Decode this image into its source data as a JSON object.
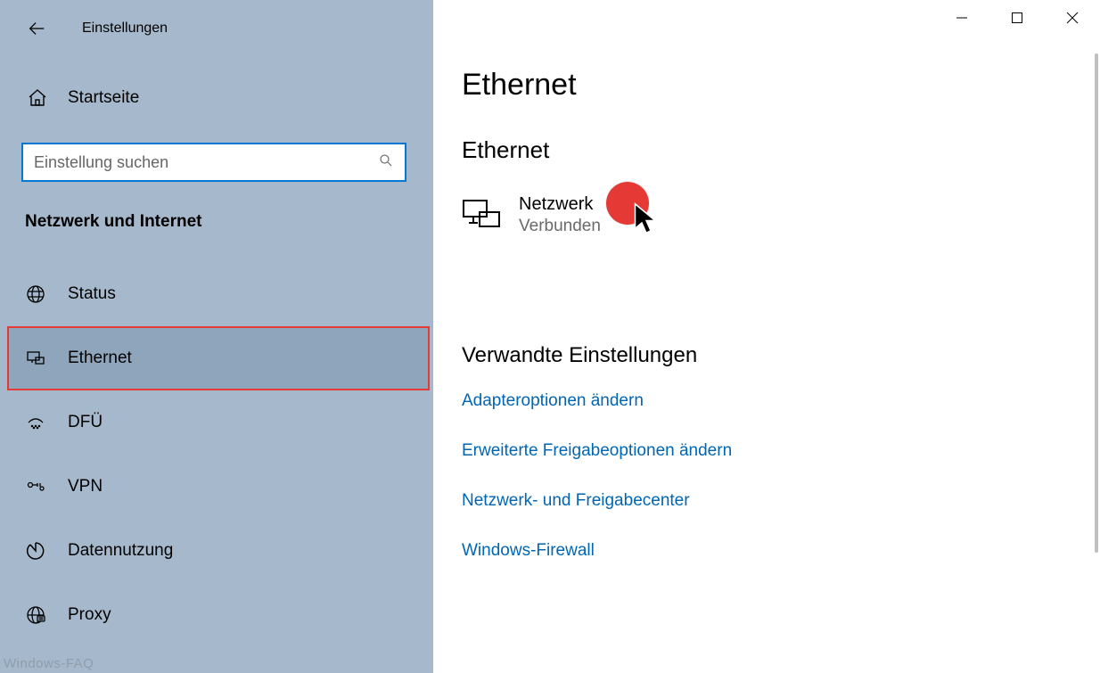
{
  "window": {
    "app_title": "Einstellungen"
  },
  "sidebar": {
    "home_label": "Startseite",
    "search_placeholder": "Einstellung suchen",
    "category_title": "Netzwerk und Internet",
    "items": [
      {
        "id": "status",
        "label": "Status",
        "selected": false
      },
      {
        "id": "ethernet",
        "label": "Ethernet",
        "selected": true
      },
      {
        "id": "dfu",
        "label": "DFÜ",
        "selected": false
      },
      {
        "id": "vpn",
        "label": "VPN",
        "selected": false
      },
      {
        "id": "datennutzung",
        "label": "Datennutzung",
        "selected": false
      },
      {
        "id": "proxy",
        "label": "Proxy",
        "selected": false
      }
    ]
  },
  "main": {
    "page_title": "Ethernet",
    "section_title": "Ethernet",
    "network": {
      "name": "Netzwerk",
      "status": "Verbunden"
    },
    "related_title": "Verwandte Einstellungen",
    "related_links": [
      "Adapteroptionen ändern",
      "Erweiterte Freigabeoptionen ändern",
      "Netzwerk- und Freigabecenter",
      "Windows-Firewall"
    ]
  },
  "watermark": "Windows-FAQ"
}
